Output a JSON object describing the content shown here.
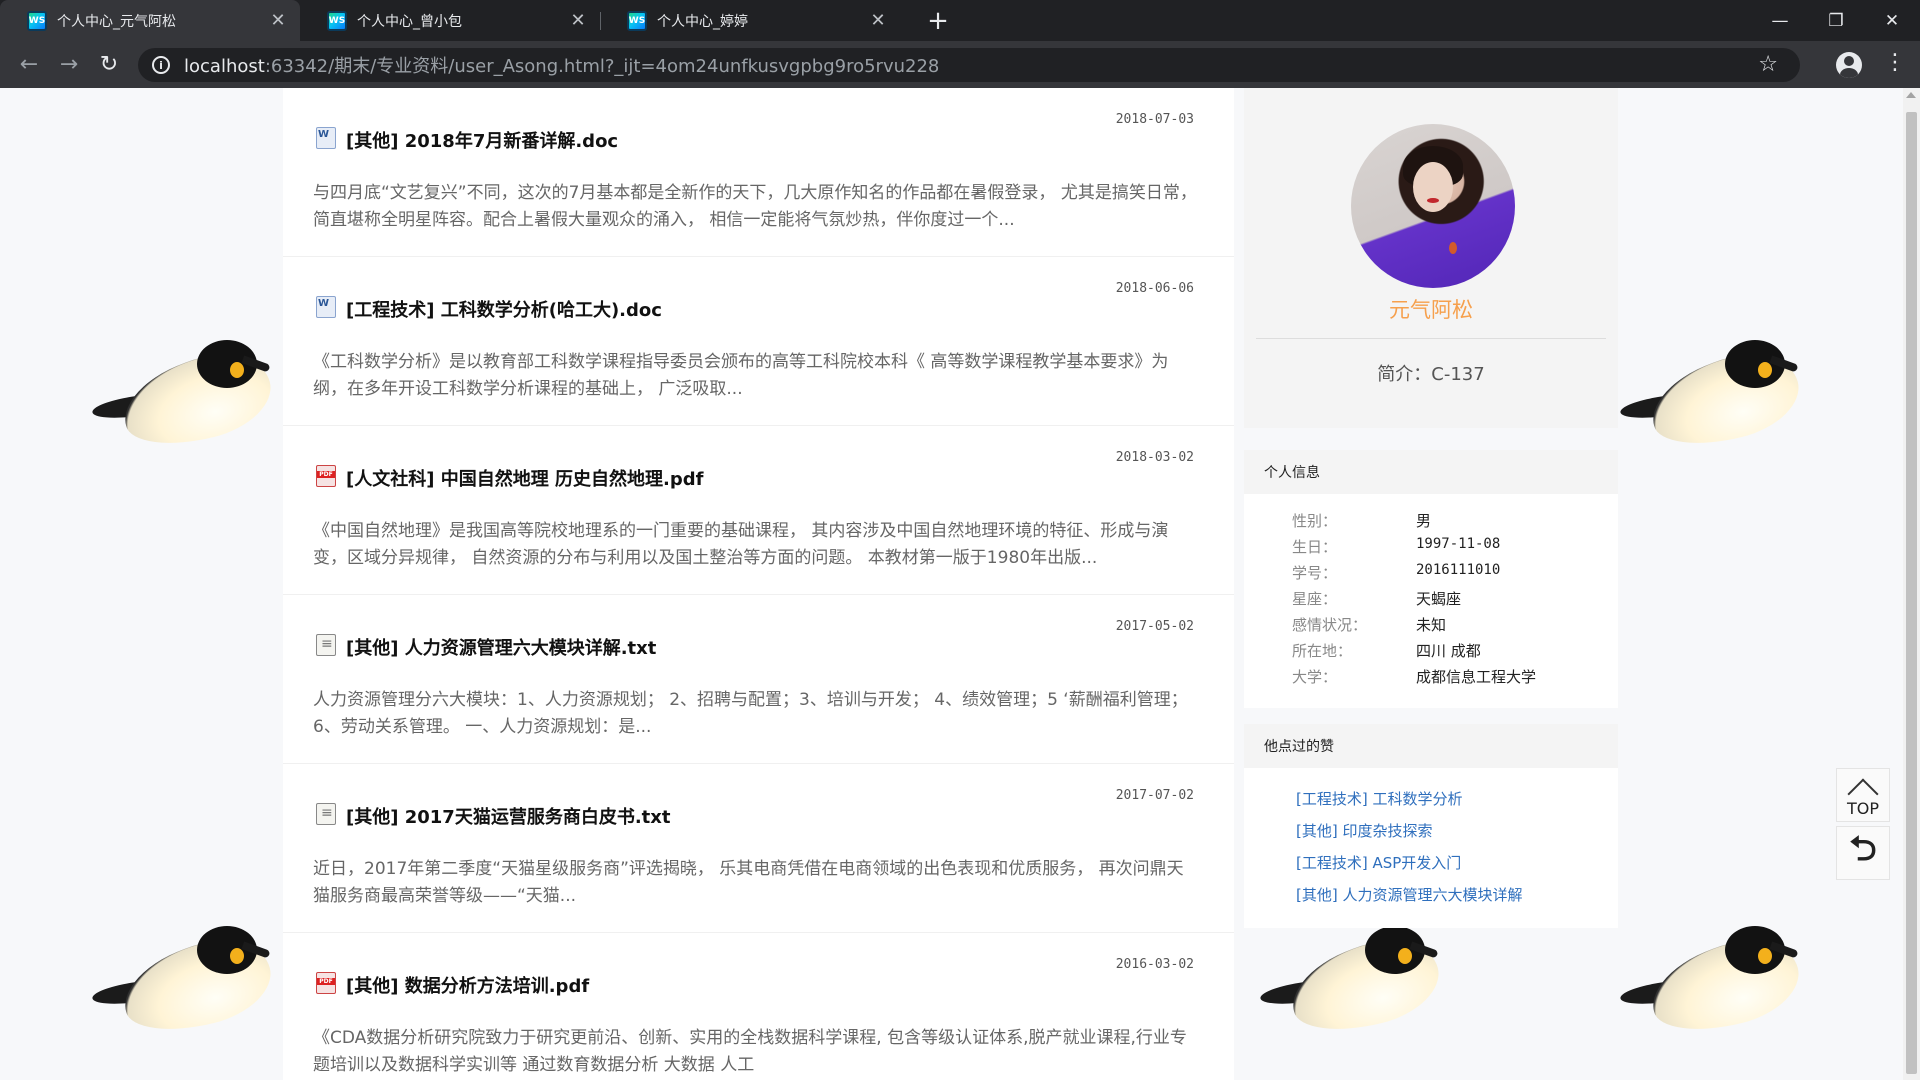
{
  "browser": {
    "tabs": [
      {
        "label": "个人中心_元气阿松",
        "active": true
      },
      {
        "label": "个人中心_曾小包",
        "active": false
      },
      {
        "label": "个人中心_婷婷",
        "active": false
      }
    ],
    "favicon_text": "WS",
    "new_tab_label": "+",
    "url_host": "localhost",
    "url_rest": ":63342/期末/专业资料/user_Asong.html?_ijt=4om24unfkusvgpbg9ro5rvu228",
    "info_icon_text": "i",
    "star_glyph": "☆",
    "menu_glyph": "⋮",
    "back_glyph": "←",
    "forward_glyph": "→",
    "reload_glyph": "↻",
    "minimize_glyph": "—",
    "maximize_glyph": "❐",
    "close_glyph": "✕",
    "tab_close_glyph": "✕"
  },
  "articles": [
    {
      "filetype": "doc",
      "date": "2018-07-03",
      "title": "[其他] 2018年7月新番详解.doc",
      "excerpt": "与四月底“文艺复兴”不同，这次的7月基本都是全新作的天下，几大原作知名的作品都在暑假登录， 尤其是搞笑日常，简直堪称全明星阵容。配合上暑假大量观众的涌入， 相信一定能将气氛炒热，伴你度过一个..."
    },
    {
      "filetype": "doc",
      "date": "2018-06-06",
      "title": "[工程技术] 工科数学分析(哈工大).doc",
      "excerpt": "《工科数学分析》是以教育部工科数学课程指导委员会颁布的高等工科院校本科《 高等数学课程教学基本要求》为纲，在多年开设工科数学分析课程的基础上， 广泛吸取..."
    },
    {
      "filetype": "pdf",
      "date": "2018-03-02",
      "title": "[人文社科] 中国自然地理 历史自然地理.pdf",
      "excerpt": "《中国自然地理》是我国高等院校地理系的一门重要的基础课程， 其内容涉及中国自然地理环境的特征、形成与演变，区域分异规律， 自然资源的分布与利用以及国土整治等方面的问题。 本教材第一版于1980年出版..."
    },
    {
      "filetype": "txt",
      "date": "2017-05-02",
      "title": "[其他] 人力资源管理六大模块详解.txt",
      "excerpt": "人力资源管理分六大模块：1、人力资源规划； 2、招聘与配置；3、培训与开发； 4、绩效管理；5 ‘薪酬福利管理； 6、劳动关系管理。 一、人力资源规划：是..."
    },
    {
      "filetype": "txt",
      "date": "2017-07-02",
      "title": "[其他] 2017天猫运营服务商白皮书.txt",
      "excerpt": "近日，2017年第二季度“天猫星级服务商”评选揭晓， 乐其电商凭借在电商领域的出色表现和优质服务， 再次问鼎天猫服务商最高荣誉等级——“天猫..."
    },
    {
      "filetype": "pdf",
      "date": "2016-03-02",
      "title": "[其他] 数据分析方法培训.pdf",
      "excerpt": "《CDA数据分析研究院致力于研究更前沿、创新、实用的全栈数据科学课程, 包含等级认证体系,脱产就业课程,行业专题培训以及数据科学实训等 通过数育数据分析 大数据 人工"
    }
  ],
  "profile": {
    "username": "元气阿松",
    "bio": "简介：C-137"
  },
  "personal_info": {
    "heading": "个人信息",
    "rows": [
      {
        "key": "性别：",
        "value": "男"
      },
      {
        "key": "生日：",
        "value": "1997-11-08"
      },
      {
        "key": "学号：",
        "value": "2016111010"
      },
      {
        "key": "星座：",
        "value": "天蝎座"
      },
      {
        "key": "感情状况：",
        "value": "未知"
      },
      {
        "key": "所在地：",
        "value": "四川 成都"
      },
      {
        "key": "大学：",
        "value": "成都信息工程大学"
      }
    ]
  },
  "likes": {
    "heading": "他点过的赞",
    "items": [
      "[工程技术] 工科数学分析",
      "[其他] 印度杂技探索",
      "[工程技术] ASP开发入门",
      "[其他] 人力资源管理六大模块详解"
    ]
  },
  "floating": {
    "top_label": "TOP",
    "back_glyph": "⮌"
  }
}
